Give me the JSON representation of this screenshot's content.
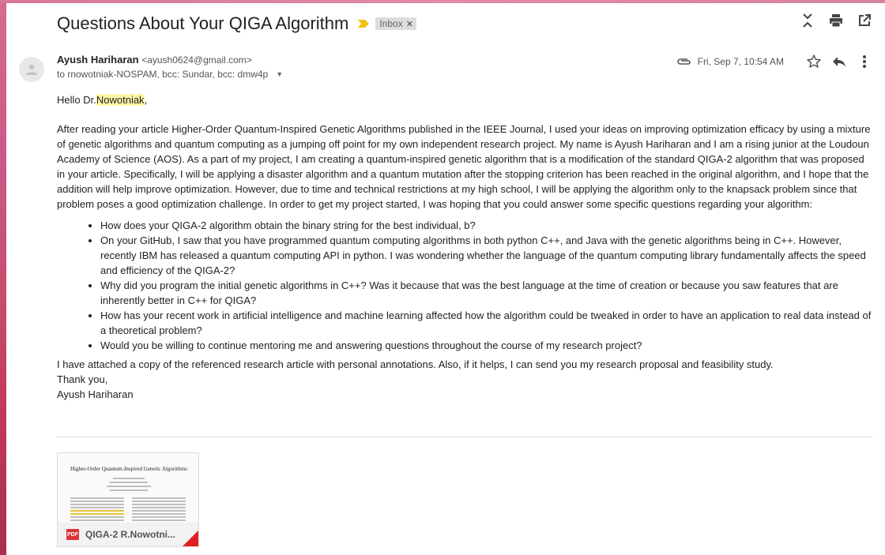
{
  "subject": "Questions About Your QIGA Algorithm",
  "label": "Inbox",
  "sender": {
    "name": "Ayush Hariharan",
    "email": "<ayush0624@gmail.com>",
    "recipients": "to rnowotniak-NOSPAM, bcc: Sundar, bcc: dmw4p"
  },
  "date": "Fri, Sep 7, 10:54 AM",
  "body": {
    "greeting_prefix": "Hello Dr.",
    "greeting_name": "Nowotniak",
    "greeting_suffix": ",",
    "paragraph1": "After reading your article Higher-Order Quantum-Inspired Genetic Algorithms published in the IEEE Journal, I used your ideas on improving optimization efficacy by using a mixture of genetic algorithms and quantum computing as a jumping off point for my own independent research project. My name is Ayush Hariharan and I am a rising junior at the Loudoun Academy of Science (AOS). As a part of my project, I am creating a quantum-inspired genetic algorithm that is a modification of the standard QIGA-2 algorithm that was proposed in your article. Specifically, I will be applying a disaster algorithm and a quantum mutation after the stopping criterion has been reached in the original algorithm, and I hope that the addition will help improve optimization. However, due to time and technical restrictions at my high school, I will be applying the algorithm only to the knapsack problem since that problem poses a good optimization challenge. In order to get my project started, I was hoping that you could answer some specific questions regarding your algorithm:",
    "questions": [
      "How does your QIGA-2 algorithm obtain the binary string for the best individual, b?",
      "On your GitHub, I saw that you have programmed quantum computing algorithms in both python C++, and Java with the genetic algorithms being in C++. However, recently IBM has released a quantum computing API in python. I was wondering whether the language of the quantum computing library fundamentally affects the speed and efficiency of the QIGA-2?",
      "Why did you program the initial genetic algorithms in C++? Was it because that was the best language at the time of creation or because you saw features that are inherently better in C++ for QIGA?",
      "How has your recent work in artificial intelligence and machine learning affected how the algorithm could be tweaked in order to have an application to real data instead of a theoretical problem?",
      "Would you be willing to continue mentoring me and answering questions throughout the course of my research project?"
    ],
    "paragraph2": "I have attached a copy of the referenced research article with personal annotations. Also, if it helps, I can send you my research proposal and feasibility study.",
    "closing": "Thank you,",
    "signature": "Ayush Hariharan"
  },
  "attachment": {
    "type_badge": "PDF",
    "filename": "QIGA-2 R.Nowotni...",
    "preview_title": "Higher-Order Quantum-Inspired Genetic Algorithms"
  },
  "icons": {
    "expand": "unfold-icon",
    "print": "print-icon",
    "popout": "open-in-new-icon",
    "attachment": "paperclip-icon",
    "star": "star-icon",
    "reply": "reply-icon",
    "more": "more-vert-icon"
  },
  "colors": {
    "importance_marker": "#f4c20d",
    "highlight": "#fff5a8",
    "pdf_red": "#db3236"
  }
}
